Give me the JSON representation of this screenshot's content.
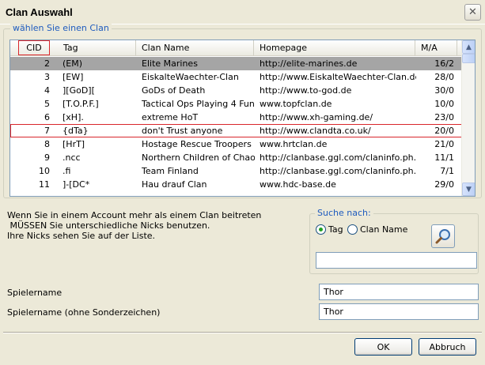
{
  "window": {
    "title": "Clan Auswahl"
  },
  "clan_group": {
    "legend": "wählen Sie einen Clan"
  },
  "table": {
    "columns": [
      "CID",
      "Tag",
      "Clan Name",
      "Homepage",
      "M/A"
    ],
    "sorted_column": "CID",
    "selected_row": 0,
    "marked_row": 5,
    "rows": [
      [
        "2",
        "(EM)",
        "Elite Marines",
        "http://elite-marines.de",
        "16/2"
      ],
      [
        "3",
        "[EW]",
        "EiskalteWaechter-Clan",
        "http://www.EiskalteWaechter-Clan.de",
        "28/0"
      ],
      [
        "4",
        "][GoD][",
        "GoDs of Death",
        "http://www.to-god.de",
        "30/0"
      ],
      [
        "5",
        "[T.O.P.F.]",
        "Tactical Ops Playing 4 Fun",
        "www.topfclan.de",
        "10/0"
      ],
      [
        "6",
        "[xH].",
        "extreme HoT",
        "http://www.xh-gaming.de/",
        "23/0"
      ],
      [
        "7",
        "{dTa}",
        "don't Trust anyone",
        "http://www.clandta.co.uk/",
        "20/0"
      ],
      [
        "8",
        "[HrT]",
        "Hostage Rescue Troopers",
        "www.hrtclan.de",
        "21/0"
      ],
      [
        "9",
        ".ncc",
        "Northern Children of Chaos",
        "http://clanbase.ggl.com/claninfo.ph...",
        "11/1"
      ],
      [
        "10",
        ".fi",
        "Team Finland",
        "http://clanbase.ggl.com/claninfo.ph...",
        "7/1"
      ],
      [
        "11",
        "]-[DC*",
        "Hau drauf Clan",
        "www.hdc-base.de",
        "29/0"
      ]
    ]
  },
  "info_text": [
    "Wenn Sie in einem Account mehr als einem Clan beitreten",
    " MÜSSEN Sie unterschiedliche Nicks benutzen.",
    "Ihre Nicks sehen Sie auf der Liste."
  ],
  "search": {
    "legend": "Suche nach:",
    "option_tag": "Tag",
    "option_clan_name": "Clan Name",
    "selected_option": "Tag",
    "value": ""
  },
  "fields": {
    "playername_label": "Spielername",
    "playername_value": "Thor",
    "playername_plain_label": "Spielername (ohne Sonderzeichen)",
    "playername_plain_value": "Thor"
  },
  "buttons": {
    "ok": "OK",
    "cancel": "Abbruch"
  },
  "icons": {
    "close": "close-icon",
    "search": "magnifier-icon"
  },
  "colors": {
    "highlight": "#D9262B",
    "legend": "#1E5BBE",
    "selected_row": "#A5A5A5"
  }
}
